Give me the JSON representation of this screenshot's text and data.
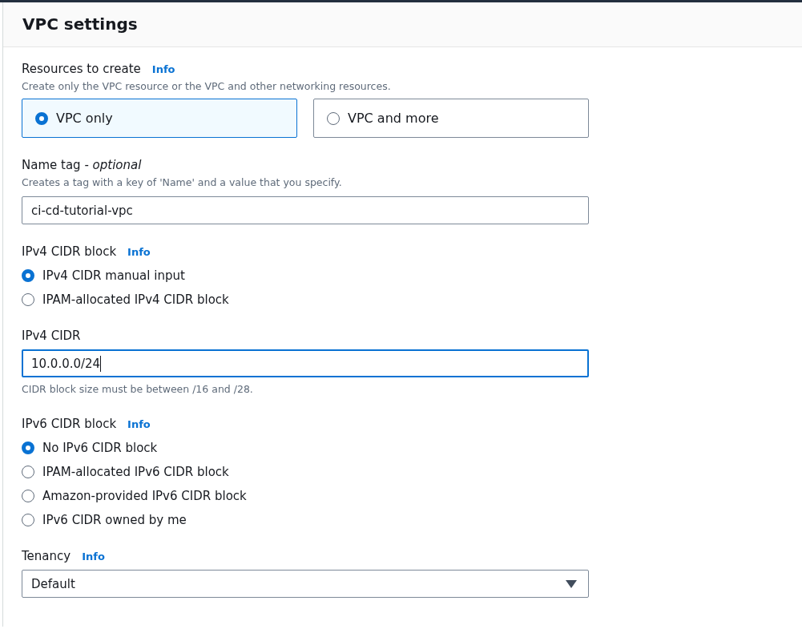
{
  "panel": {
    "title": "VPC settings"
  },
  "fields": [
    {
      "kind": "tiles",
      "label": "Resources to create",
      "info": "Info",
      "description": "Create only the VPC resource or the VPC and other networking resources.",
      "options": [
        {
          "label": "VPC only",
          "selected": true
        },
        {
          "label": "VPC and more",
          "selected": false
        }
      ]
    },
    {
      "kind": "input",
      "label": "Name tag - *optional*",
      "description": "Creates a tag with a key of 'Name' and a value that you specify.",
      "value": "ci-cd-tutorial-vpc",
      "focused": false
    },
    {
      "kind": "radios",
      "label": "IPv4 CIDR block",
      "info": "Info",
      "options": [
        {
          "label": "IPv4 CIDR manual input",
          "selected": true
        },
        {
          "label": "IPAM-allocated IPv4 CIDR block",
          "selected": false
        }
      ]
    },
    {
      "kind": "input",
      "label": "IPv4 CIDR",
      "value": "10.0.0.0/24",
      "focused": true,
      "hint": "CIDR block size must be between /16 and /28."
    },
    {
      "kind": "radios",
      "label": "IPv6 CIDR block",
      "info": "Info",
      "options": [
        {
          "label": "No IPv6 CIDR block",
          "selected": true
        },
        {
          "label": "IPAM-allocated IPv6 CIDR block",
          "selected": false
        },
        {
          "label": "Amazon-provided IPv6 CIDR block",
          "selected": false
        },
        {
          "label": "IPv6 CIDR owned by me",
          "selected": false
        }
      ]
    },
    {
      "kind": "select",
      "label": "Tenancy",
      "info": "Info",
      "value": "Default"
    }
  ]
}
